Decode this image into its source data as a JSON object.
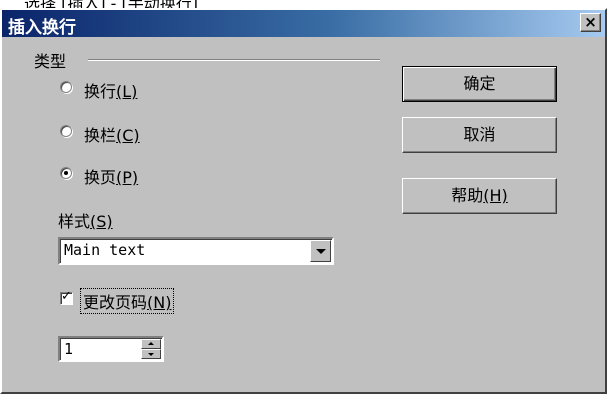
{
  "window": {
    "title": "插入换行",
    "close_label": "×",
    "header_fragment": "选择 [插入] - [手动换行]"
  },
  "group": {
    "label": "类型",
    "options": [
      {
        "label": "换行",
        "mnemonic": "(L)",
        "selected": false
      },
      {
        "label": "换栏",
        "mnemonic": "(C)",
        "selected": false
      },
      {
        "label": "换页",
        "mnemonic": "(P)",
        "selected": true
      }
    ]
  },
  "style": {
    "label": "样式",
    "mnemonic": "(S)",
    "selected_value": "Main text"
  },
  "page_number": {
    "checkbox_label": "更改页码",
    "mnemonic": "(N)",
    "checked": true,
    "value": "1"
  },
  "buttons": {
    "ok": "确定",
    "cancel": "取消",
    "help": "帮助",
    "help_mnemonic": "(H)"
  }
}
